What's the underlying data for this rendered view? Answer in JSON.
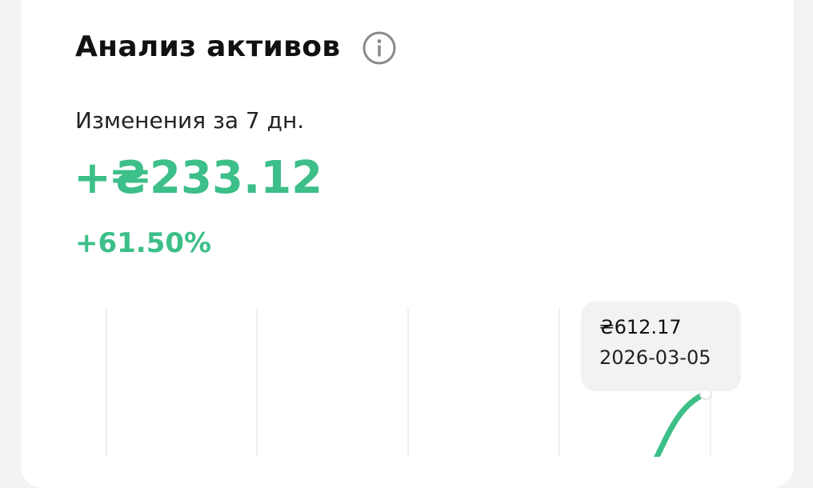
{
  "card": {
    "title": "Анализ активов",
    "info_icon": "info-circle-icon"
  },
  "summary": {
    "change_label": "Изменения за 7 дн.",
    "change_amount": "+₴233.12",
    "change_percent": "+61.50%"
  },
  "colors": {
    "positive": "#3cbf88",
    "grid": "#eeeeee",
    "tooltip_bg": "#f2f2f2"
  },
  "tooltip": {
    "value": "₴612.17",
    "date": "2026-03-05"
  }
}
